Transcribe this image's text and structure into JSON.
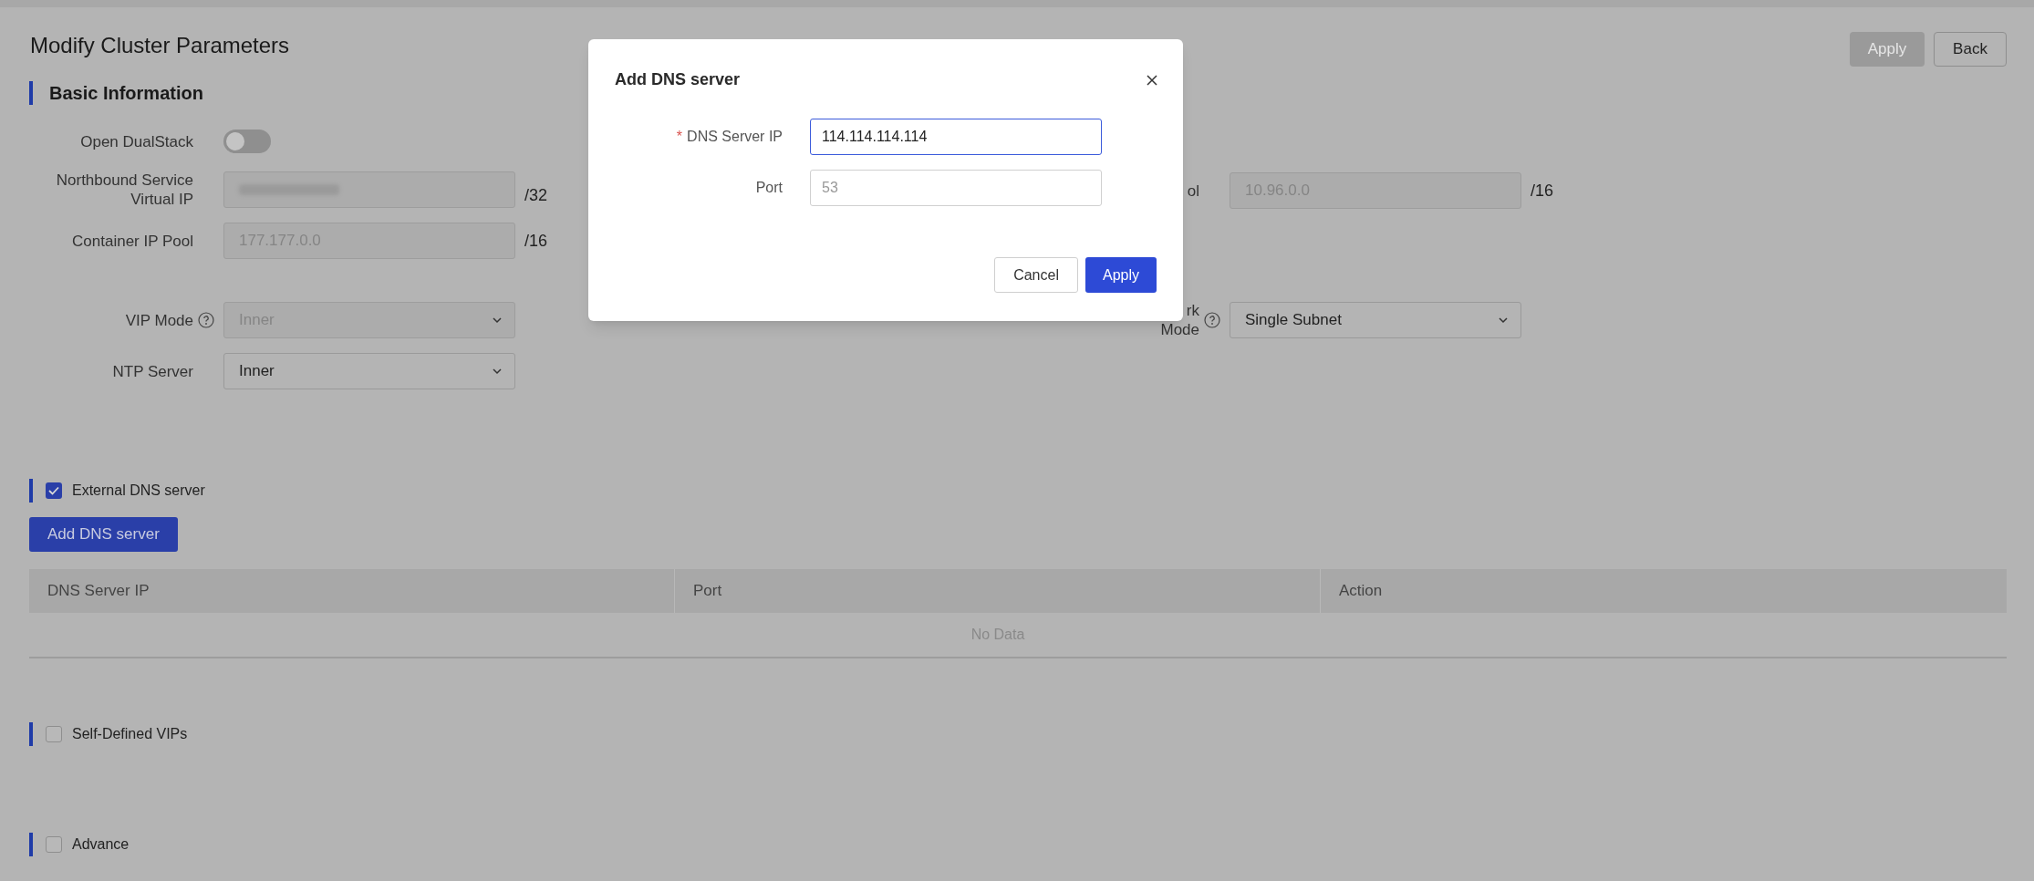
{
  "page": {
    "title": "Modify Cluster Parameters",
    "actions": [
      {
        "label": "Apply",
        "disabled": true
      },
      {
        "label": "Back",
        "disabled": false
      }
    ]
  },
  "basic_information": {
    "heading": "Basic Information",
    "left_groups": [
      [
        {
          "kind": "toggle",
          "label": "Open DualStack",
          "on": false
        },
        {
          "kind": "text",
          "label": [
            "Northbound Service",
            "Virtual IP"
          ],
          "redacted": true,
          "suffix": "/32",
          "disabled": true
        },
        {
          "kind": "text",
          "label": "Container IP Pool",
          "value": "177.177.0.0",
          "suffix": "/16",
          "disabled": true
        }
      ],
      [
        {
          "kind": "select",
          "label": "VIP Mode",
          "help": true,
          "value": "Inner",
          "disabled": true
        },
        {
          "kind": "select",
          "label": "NTP Server",
          "help": false,
          "value": "Inner",
          "disabled": false
        }
      ]
    ],
    "right_groups": [
      [
        {
          "kind": "text",
          "label": "ol",
          "value": "10.96.0.0",
          "suffix": "/16",
          "disabled": true
        }
      ],
      [
        {
          "kind": "select",
          "label": [
            "rk",
            "Mode"
          ],
          "help": true,
          "value": "Single Subnet",
          "disabled": false
        }
      ]
    ]
  },
  "sections": [
    {
      "kind": "table",
      "heading": "External DNS server",
      "checked": true,
      "add_button": "Add DNS server",
      "columns": [
        "DNS Server IP",
        "Port",
        "Action"
      ],
      "empty_text": "No Data"
    },
    {
      "kind": "plain",
      "heading": "Self-Defined VIPs",
      "checked": false
    },
    {
      "kind": "plain",
      "heading": "Advance",
      "checked": false
    }
  ],
  "dialog": {
    "title": "Add DNS server",
    "fields": [
      {
        "label": "DNS Server IP",
        "required_mark": "*",
        "value": "114.114.114.114",
        "focused": true
      },
      {
        "label": "Port",
        "placeholder": "53",
        "focused": false
      }
    ],
    "buttons": [
      {
        "label": "Cancel",
        "kind": "secondary"
      },
      {
        "label": "Apply",
        "kind": "primary"
      }
    ]
  }
}
